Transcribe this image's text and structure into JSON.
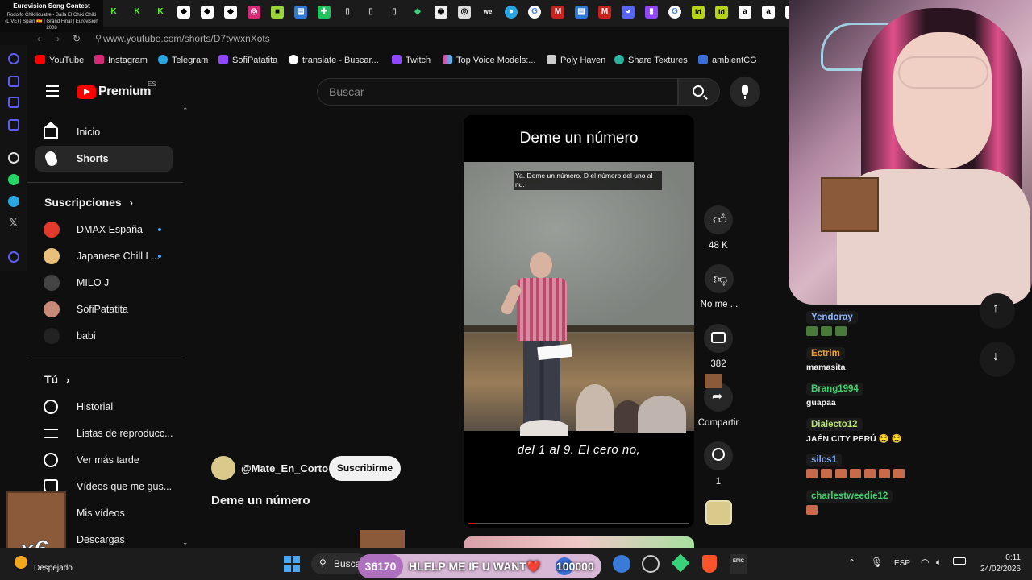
{
  "overlay": {
    "title": "Eurovision Song Contest",
    "subtitle": "Rodolfo Chikilicuatre - Baila El Chiki Chiki (LIVE) | Spain 🇪🇸 | Grand Final | Eurovision 2008"
  },
  "browser": {
    "url": "www.youtube.com/shorts/D7tvwxnXots"
  },
  "bookmarks": [
    "YouTube",
    "Instagram",
    "Telegram",
    "SofiPatatita",
    "translate - Buscar...",
    "Twitch",
    "Top Voice Models:...",
    "Poly Haven",
    "Share Textures",
    "ambientCG"
  ],
  "youtube": {
    "logo": "Premium",
    "region": "ES",
    "search_placeholder": "Buscar"
  },
  "sidebar": {
    "home": "Inicio",
    "shorts": "Shorts",
    "subs_title": "Suscripciones",
    "subs": [
      "DMAX España",
      "Japanese Chill L...",
      "MILO J",
      "SofiPatatita",
      "babi"
    ],
    "you_title": "Tú",
    "you": [
      "Historial",
      "Listas de reproducc...",
      "Ver más tarde",
      "Vídeos que me gus...",
      "Mis vídeos",
      "Descargas"
    ]
  },
  "video": {
    "title": "Deme un número",
    "caption_top": "Ya. Deme un número. D el número del uno al nu.",
    "caption_bottom": "del 1 al 9. El cero no,",
    "progress": 0.03
  },
  "actions": {
    "likes": "48 K",
    "dislike": "No me ...",
    "comments": "382",
    "share": "Compartir",
    "remix": "1"
  },
  "channel": {
    "handle": "@Mate_En_Corto",
    "subscribe": "Suscribirme",
    "video_name": "Deme un número"
  },
  "chat": [
    {
      "user": "Yendoray",
      "color": "#8fb6ff",
      "text": ""
    },
    {
      "user": "Ectrim",
      "color": "#f0a020",
      "text": "mamasita"
    },
    {
      "user": "Brang1994",
      "color": "#3ed36a",
      "text": "guapaa"
    },
    {
      "user": "Dialecto12",
      "color": "#b7e36b",
      "text": "JAÉN CITY PERÚ 🤤 🤤"
    },
    {
      "user": "silcs1",
      "color": "#7aa7ff",
      "text": ""
    },
    {
      "user": "charlestweedie12",
      "color": "#3ed36a",
      "text": ""
    }
  ],
  "stream_overlay": {
    "count_left": "36170",
    "message": "HLELP ME IF U WANT❤️",
    "count_right": "100000",
    "multiplier": "x6"
  },
  "taskbar": {
    "weather": "Despejado",
    "search": "Busca",
    "lang": "ESP",
    "time": "0:11",
    "date": "24/02/2026"
  }
}
